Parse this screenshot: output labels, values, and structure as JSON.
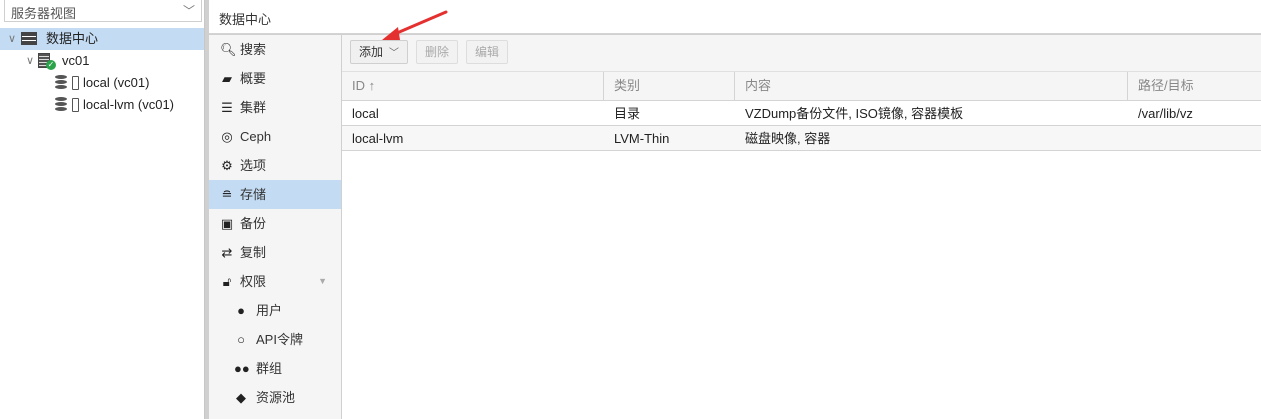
{
  "sidebar": {
    "view_select": "服务器视图",
    "tree": [
      {
        "label": "数据中心"
      },
      {
        "label": "vc01"
      },
      {
        "label": "local (vc01)"
      },
      {
        "label": "local-lvm (vc01)"
      }
    ]
  },
  "header": {
    "title": "数据中心"
  },
  "nav": {
    "items": [
      {
        "label": "搜索",
        "icon": "search-icon"
      },
      {
        "label": "概要",
        "icon": "book-icon"
      },
      {
        "label": "集群",
        "icon": "server-icon"
      },
      {
        "label": "Ceph",
        "icon": "ceph-icon"
      },
      {
        "label": "选项",
        "icon": "gear-icon"
      },
      {
        "label": "存储",
        "icon": "database-icon"
      },
      {
        "label": "备份",
        "icon": "floppy-icon"
      },
      {
        "label": "复制",
        "icon": "retweet-icon"
      },
      {
        "label": "权限",
        "icon": "unlock-icon"
      },
      {
        "label": "用户",
        "icon": "user-icon"
      },
      {
        "label": "API令牌",
        "icon": "user-outline-icon"
      },
      {
        "label": "群组",
        "icon": "users-icon"
      },
      {
        "label": "资源池",
        "icon": "tags-icon"
      }
    ]
  },
  "toolbar": {
    "add": "添加",
    "remove": "删除",
    "edit": "编辑"
  },
  "table": {
    "columns": [
      "ID ↑",
      "类别",
      "内容",
      "路径/目标"
    ],
    "rows": [
      [
        "local",
        "目录",
        "VZDump备份文件, ISO镜像, 容器模板",
        "/var/lib/vz"
      ],
      [
        "local-lvm",
        "LVM-Thin",
        "磁盘映像, 容器",
        ""
      ]
    ]
  },
  "colors": {
    "selection": "#c3dbf3",
    "annotation_arrow": "#e53030"
  }
}
